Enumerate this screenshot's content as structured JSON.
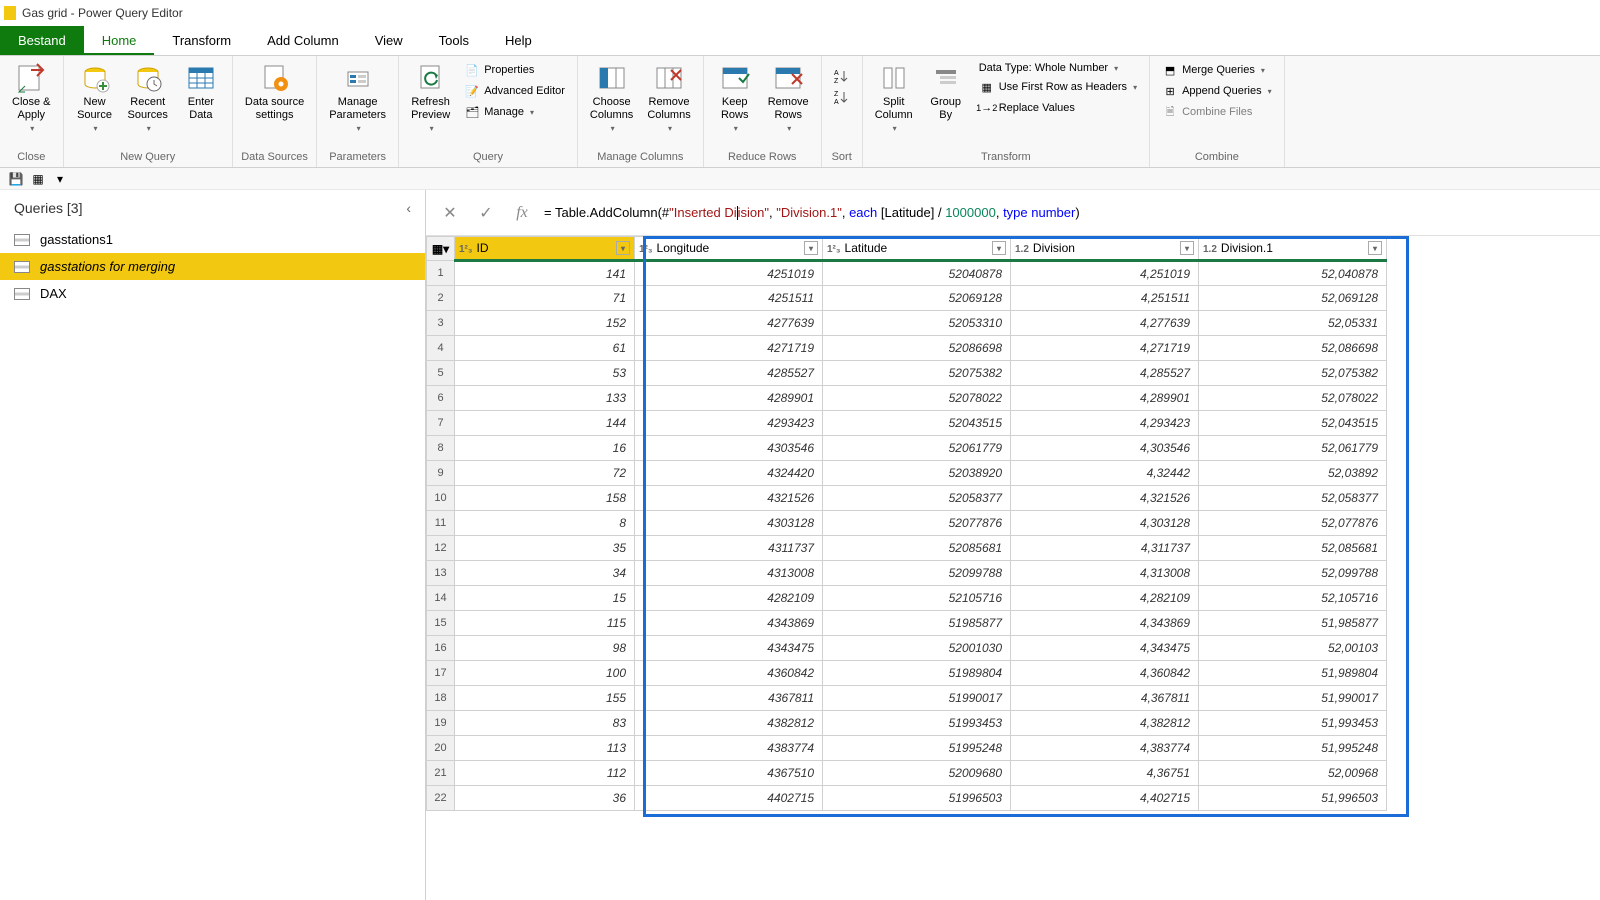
{
  "window": {
    "title": "Gas grid - Power Query Editor"
  },
  "tabs": {
    "file": "Bestand",
    "home": "Home",
    "transform": "Transform",
    "addcolumn": "Add Column",
    "view": "View",
    "tools": "Tools",
    "help": "Help"
  },
  "ribbon": {
    "close_apply": "Close &\nApply",
    "close": "Close",
    "new_source": "New\nSource",
    "recent_sources": "Recent\nSources",
    "enter_data": "Enter\nData",
    "new_query": "New Query",
    "data_source_settings": "Data source\nsettings",
    "data_sources": "Data Sources",
    "manage_parameters": "Manage\nParameters",
    "parameters": "Parameters",
    "refresh_preview": "Refresh\nPreview",
    "properties": "Properties",
    "advanced_editor": "Advanced Editor",
    "manage": "Manage",
    "query": "Query",
    "choose_columns": "Choose\nColumns",
    "remove_columns": "Remove\nColumns",
    "manage_columns": "Manage Columns",
    "keep_rows": "Keep\nRows",
    "remove_rows": "Remove\nRows",
    "reduce_rows": "Reduce Rows",
    "sort": "Sort",
    "split_column": "Split\nColumn",
    "group_by": "Group\nBy",
    "data_type": "Data Type: Whole Number",
    "first_row_headers": "Use First Row as Headers",
    "replace_values": "Replace Values",
    "transform": "Transform",
    "merge_queries": "Merge Queries",
    "append_queries": "Append Queries",
    "combine_files": "Combine Files",
    "combine": "Combine"
  },
  "queries": {
    "header": "Queries [3]",
    "items": [
      "gasstations1",
      "gasstations for merging",
      "DAX"
    ]
  },
  "formula": {
    "prefix": "= Table.AddColumn(#",
    "arg1": "\"Inserted Di",
    "arg1b": "ision\"",
    "comma1": ", ",
    "arg2": "\"Division.1\"",
    "comma2": ", ",
    "each": "each",
    "expr": " [Latitude] / ",
    "num": "1000000",
    "comma3": ", ",
    "type": "type number",
    "close": ")"
  },
  "columns": [
    {
      "type": "1²₃",
      "name": "ID"
    },
    {
      "type": "1²₃",
      "name": "Longitude"
    },
    {
      "type": "1²₃",
      "name": "Latitude"
    },
    {
      "type": "1.2",
      "name": "Division"
    },
    {
      "type": "1.2",
      "name": "Division.1"
    }
  ],
  "rows": [
    {
      "n": 1,
      "id": "141",
      "lon": "4251019",
      "lat": "52040878",
      "div": "4,251019",
      "div1": "52,040878"
    },
    {
      "n": 2,
      "id": "71",
      "lon": "4251511",
      "lat": "52069128",
      "div": "4,251511",
      "div1": "52,069128"
    },
    {
      "n": 3,
      "id": "152",
      "lon": "4277639",
      "lat": "52053310",
      "div": "4,277639",
      "div1": "52,05331"
    },
    {
      "n": 4,
      "id": "61",
      "lon": "4271719",
      "lat": "52086698",
      "div": "4,271719",
      "div1": "52,086698"
    },
    {
      "n": 5,
      "id": "53",
      "lon": "4285527",
      "lat": "52075382",
      "div": "4,285527",
      "div1": "52,075382"
    },
    {
      "n": 6,
      "id": "133",
      "lon": "4289901",
      "lat": "52078022",
      "div": "4,289901",
      "div1": "52,078022"
    },
    {
      "n": 7,
      "id": "144",
      "lon": "4293423",
      "lat": "52043515",
      "div": "4,293423",
      "div1": "52,043515"
    },
    {
      "n": 8,
      "id": "16",
      "lon": "4303546",
      "lat": "52061779",
      "div": "4,303546",
      "div1": "52,061779"
    },
    {
      "n": 9,
      "id": "72",
      "lon": "4324420",
      "lat": "52038920",
      "div": "4,32442",
      "div1": "52,03892"
    },
    {
      "n": 10,
      "id": "158",
      "lon": "4321526",
      "lat": "52058377",
      "div": "4,321526",
      "div1": "52,058377"
    },
    {
      "n": 11,
      "id": "8",
      "lon": "4303128",
      "lat": "52077876",
      "div": "4,303128",
      "div1": "52,077876"
    },
    {
      "n": 12,
      "id": "35",
      "lon": "4311737",
      "lat": "52085681",
      "div": "4,311737",
      "div1": "52,085681"
    },
    {
      "n": 13,
      "id": "34",
      "lon": "4313008",
      "lat": "52099788",
      "div": "4,313008",
      "div1": "52,099788"
    },
    {
      "n": 14,
      "id": "15",
      "lon": "4282109",
      "lat": "52105716",
      "div": "4,282109",
      "div1": "52,105716"
    },
    {
      "n": 15,
      "id": "115",
      "lon": "4343869",
      "lat": "51985877",
      "div": "4,343869",
      "div1": "51,985877"
    },
    {
      "n": 16,
      "id": "98",
      "lon": "4343475",
      "lat": "52001030",
      "div": "4,343475",
      "div1": "52,00103"
    },
    {
      "n": 17,
      "id": "100",
      "lon": "4360842",
      "lat": "51989804",
      "div": "4,360842",
      "div1": "51,989804"
    },
    {
      "n": 18,
      "id": "155",
      "lon": "4367811",
      "lat": "51990017",
      "div": "4,367811",
      "div1": "51,990017"
    },
    {
      "n": 19,
      "id": "83",
      "lon": "4382812",
      "lat": "51993453",
      "div": "4,382812",
      "div1": "51,993453"
    },
    {
      "n": 20,
      "id": "113",
      "lon": "4383774",
      "lat": "51995248",
      "div": "4,383774",
      "div1": "51,995248"
    },
    {
      "n": 21,
      "id": "112",
      "lon": "4367510",
      "lat": "52009680",
      "div": "4,36751",
      "div1": "52,00968"
    },
    {
      "n": 22,
      "id": "36",
      "lon": "4402715",
      "lat": "51996503",
      "div": "4,402715",
      "div1": "51,996503"
    }
  ]
}
